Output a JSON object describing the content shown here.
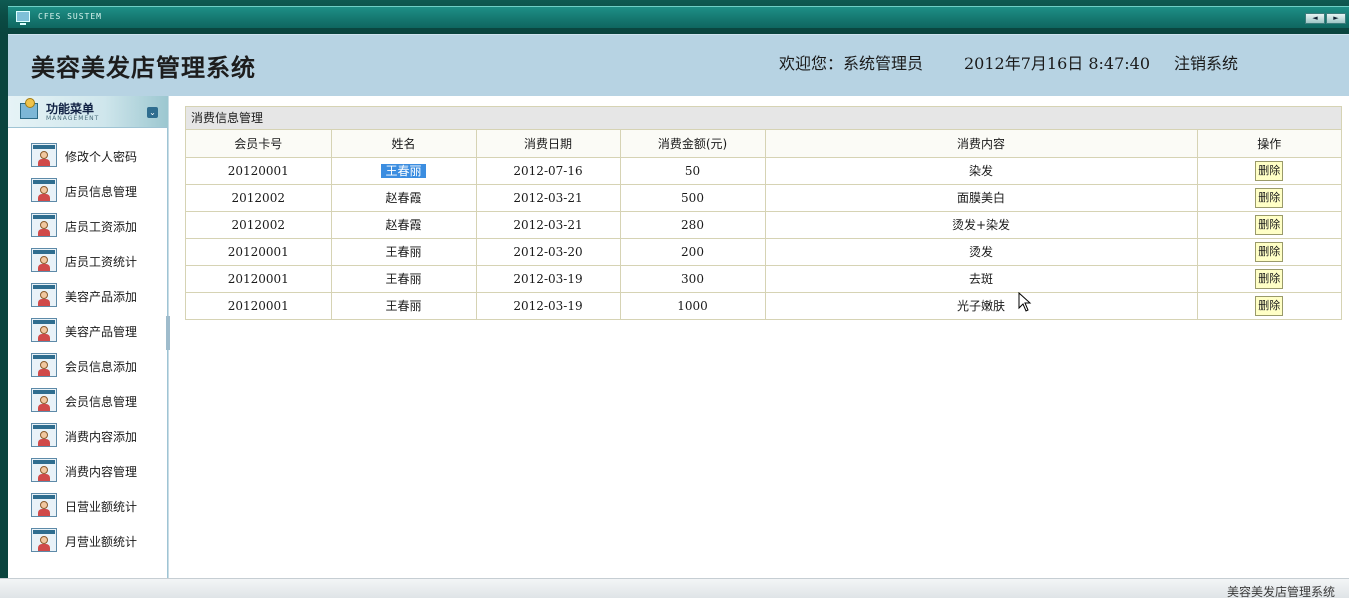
{
  "sysbar": {
    "title": "CFES SUSTEM",
    "prev": "◄",
    "next": "►"
  },
  "header": {
    "app_title": "美容美发店管理系统",
    "welcome": "欢迎您：系统管理员",
    "datetime": "2012年7月16日  8:47:40",
    "logout": "注销系统"
  },
  "sidebar": {
    "title": "功能菜单",
    "subtitle": "MANAGEMENT",
    "items": [
      {
        "label": "修改个人密码"
      },
      {
        "label": "店员信息管理"
      },
      {
        "label": "店员工资添加"
      },
      {
        "label": "店员工资统计"
      },
      {
        "label": "美容产品添加"
      },
      {
        "label": "美容产品管理"
      },
      {
        "label": "会员信息添加"
      },
      {
        "label": "会员信息管理"
      },
      {
        "label": "消费内容添加"
      },
      {
        "label": "消费内容管理"
      },
      {
        "label": "日营业额统计"
      },
      {
        "label": "月营业额统计"
      }
    ]
  },
  "main": {
    "panel_title": "消费信息管理",
    "columns": [
      "会员卡号",
      "姓名",
      "消费日期",
      "消费金额(元)",
      "消费内容",
      "操作"
    ],
    "rows": [
      {
        "card": "20120001",
        "name": "王春丽",
        "date": "2012-07-16",
        "amount": "50",
        "content": "染发",
        "action": "删除"
      },
      {
        "card": "2012002",
        "name": "赵春霞",
        "date": "2012-03-21",
        "amount": "500",
        "content": "面膜美白",
        "action": "删除"
      },
      {
        "card": "2012002",
        "name": "赵春霞",
        "date": "2012-03-21",
        "amount": "280",
        "content": "烫发+染发",
        "action": "删除"
      },
      {
        "card": "20120001",
        "name": "王春丽",
        "date": "2012-03-20",
        "amount": "200",
        "content": "烫发",
        "action": "删除"
      },
      {
        "card": "20120001",
        "name": "王春丽",
        "date": "2012-03-19",
        "amount": "300",
        "content": "去斑",
        "action": "删除"
      },
      {
        "card": "20120001",
        "name": "王春丽",
        "date": "2012-03-19",
        "amount": "1000",
        "content": "光子嫩肤",
        "action": "删除"
      }
    ]
  },
  "footer": {
    "text": "美容美发店管理系统"
  }
}
